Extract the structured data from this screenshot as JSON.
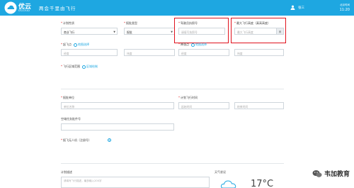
{
  "header": {
    "brand_name": "优云",
    "brand_sub": "UCLOUD",
    "slogan": "两会千里由飞行",
    "user_name": "张三",
    "clock_label": "北京时间",
    "clock_time": "11:20"
  },
  "form": {
    "plan_type_label": "计划性质",
    "plan_type_value": "商业飞行",
    "report_type_label": "报批类型",
    "report_type_value": "报批",
    "pilot_license_label": "驾驶员执照号",
    "pilot_license_placeholder": "请填写执照号",
    "max_altitude_label": "最大飞行高度（真高高度）",
    "max_altitude_placeholder": "最大飞行高度",
    "max_altitude_unit": "米",
    "takeoff_label": "起飞点",
    "takeoff_link": "地图选择",
    "takeoff_lng_placeholder": "经度",
    "takeoff_lat_placeholder": "纬度",
    "landing_label": "降落点",
    "landing_link": "地图选择",
    "landing_lng_placeholder": "经度",
    "landing_lat_placeholder": "纬度",
    "area_label": "飞行区域范围",
    "area_link": "区域绘制",
    "unit_label": "报批单位",
    "unit_placeholder": "单位名称",
    "time_label": "计划飞行时间",
    "time_start_placeholder": "起始时间",
    "time_end_placeholder": "结束时间",
    "mission_label": "空域任务批件号",
    "drone_label": "报飞无人机（注册号）",
    "plan_desc_label": "计划描述",
    "plan_desc_placeholder": "请填写飞行描述，最多输入200字",
    "weather_label": "天气状况",
    "weather_temp": "17°C"
  },
  "watermark": {
    "text": "韦加教育"
  },
  "colors": {
    "header_bg": "#1ea7e1",
    "highlight": "#e0121d",
    "required": "#e02020",
    "link": "#1ea7e1"
  },
  "icons": {
    "logo": "cloud-logo-icon",
    "user": "user-icon",
    "map": "map-pin-icon",
    "add": "plus-circle-icon",
    "weather": "cloud-icon",
    "watermark": "wechat-icon"
  }
}
